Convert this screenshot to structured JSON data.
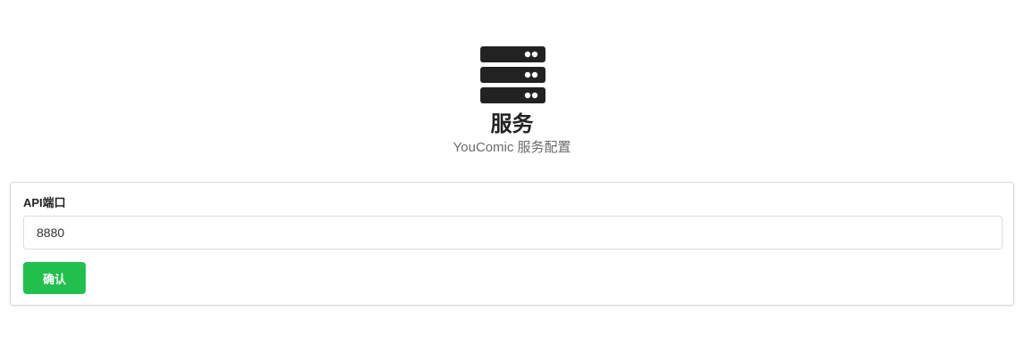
{
  "header": {
    "icon": "server-icon",
    "title": "服务",
    "subtitle": "YouComic 服务配置"
  },
  "form": {
    "api_port_label": "API端口",
    "api_port_value": "8880",
    "confirm_label": "确认",
    "confirm_color": "#21c04d"
  }
}
